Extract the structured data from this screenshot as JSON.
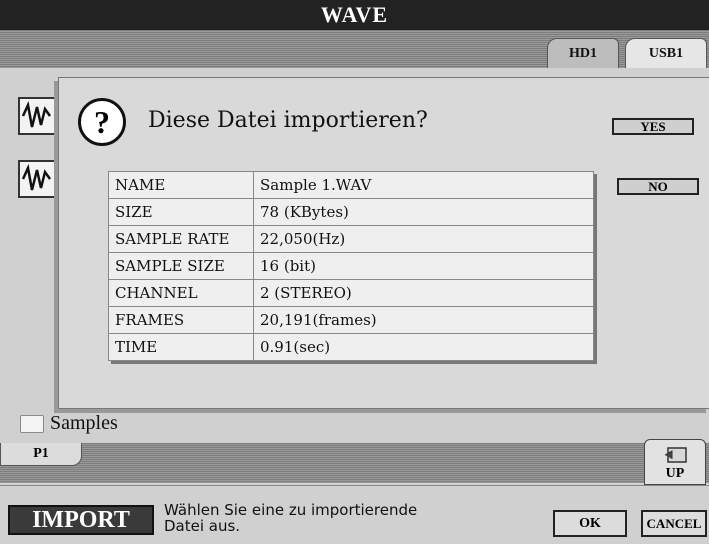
{
  "header": {
    "title": "WAVE"
  },
  "drive_tabs": [
    {
      "label": "HD1",
      "selected": false
    },
    {
      "label": "USB1",
      "selected": true
    }
  ],
  "dialog": {
    "question": "Diese Datei importieren?",
    "yes_label": "YES",
    "no_label": "NO",
    "info_rows": [
      {
        "key": "NAME",
        "value": "Sample 1.WAV"
      },
      {
        "key": "SIZE",
        "value": "78 (KBytes)"
      },
      {
        "key": "SAMPLE RATE",
        "value": "22,050(Hz)"
      },
      {
        "key": "SAMPLE SIZE",
        "value": "16 (bit)"
      },
      {
        "key": "CHANNEL",
        "value": "2 (STEREO)"
      },
      {
        "key": "FRAMES",
        "value": "20,191(frames)"
      },
      {
        "key": "TIME",
        "value": "0.91(sec)"
      }
    ]
  },
  "folder": {
    "label": "Samples"
  },
  "page_tab": {
    "label": "P1"
  },
  "up_button": {
    "label": "UP"
  },
  "footer": {
    "mode": "IMPORT",
    "instruction_line1": "Wählen Sie eine zu importierende",
    "instruction_line2": "Datei aus.",
    "ok_label": "OK",
    "cancel_label": "CANCEL"
  }
}
